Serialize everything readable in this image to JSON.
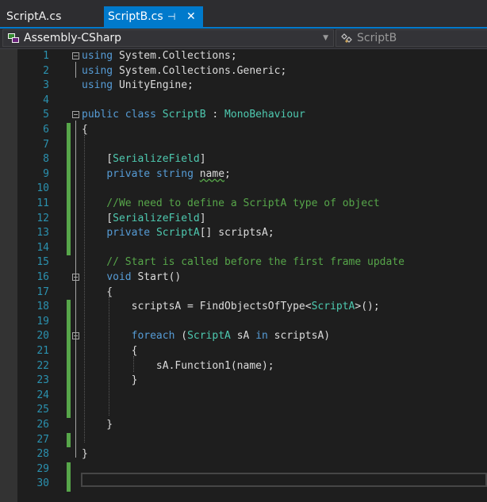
{
  "tabs": [
    {
      "label": "ScriptA.cs",
      "active": false
    },
    {
      "label": "ScriptB.cs",
      "active": true,
      "pin_icon": "pin-icon",
      "close_icon": "close-icon"
    }
  ],
  "nav": {
    "project": "Assembly-CSharp",
    "project_icon": "csharp-project-icon",
    "dropdown_icon": "chevron-down-icon",
    "class": "ScriptB",
    "class_icon": "class-icon"
  },
  "colors": {
    "accent": "#007acc",
    "keyword": "#569cd6",
    "type": "#4ec9b0",
    "comment": "#57a64a",
    "line_number": "#2b91af",
    "text": "#dcdcdc",
    "change_saved": "#57a64a",
    "change_unsaved": "#efef91"
  },
  "editor": {
    "lines": [
      {
        "n": "1",
        "change": "",
        "fold": true,
        "tokens": [
          {
            "t": "using",
            "c": "kw"
          },
          {
            "t": " System.Collections;"
          }
        ]
      },
      {
        "n": "2",
        "change": "",
        "fold": false,
        "tokens": [
          {
            "t": "using",
            "c": "kw"
          },
          {
            "t": " System.Collections.Generic;"
          }
        ]
      },
      {
        "n": "3",
        "change": "",
        "fold": false,
        "tokens": [
          {
            "t": "using",
            "c": "kw"
          },
          {
            "t": " UnityEngine;"
          }
        ]
      },
      {
        "n": "4",
        "change": "",
        "fold": false,
        "tokens": []
      },
      {
        "n": "5",
        "change": "",
        "fold": true,
        "tokens": [
          {
            "t": "public",
            "c": "kw"
          },
          {
            "t": " "
          },
          {
            "t": "class",
            "c": "kw"
          },
          {
            "t": " "
          },
          {
            "t": "ScriptB",
            "c": "ty"
          },
          {
            "t": " : "
          },
          {
            "t": "MonoBehaviour",
            "c": "ty"
          }
        ]
      },
      {
        "n": "6",
        "change": "saved",
        "fold": false,
        "tokens": [
          {
            "t": "{"
          }
        ]
      },
      {
        "n": "7",
        "change": "saved",
        "fold": false,
        "tokens": []
      },
      {
        "n": "8",
        "change": "saved",
        "fold": false,
        "tokens": [
          {
            "t": "    ["
          },
          {
            "t": "SerializeField",
            "c": "ty"
          },
          {
            "t": "]"
          }
        ]
      },
      {
        "n": "9",
        "change": "saved",
        "fold": false,
        "tokens": [
          {
            "t": "    "
          },
          {
            "t": "private",
            "c": "kw"
          },
          {
            "t": " "
          },
          {
            "t": "string",
            "c": "kw"
          },
          {
            "t": " "
          },
          {
            "t": "name",
            "c": "squig"
          },
          {
            "t": ";"
          }
        ]
      },
      {
        "n": "10",
        "change": "saved",
        "fold": false,
        "tokens": []
      },
      {
        "n": "11",
        "change": "saved",
        "fold": false,
        "tokens": [
          {
            "t": "    //We need to define a ScriptA type of object",
            "c": "cm"
          }
        ]
      },
      {
        "n": "12",
        "change": "saved",
        "fold": false,
        "tokens": [
          {
            "t": "    ["
          },
          {
            "t": "SerializeField",
            "c": "ty"
          },
          {
            "t": "]"
          }
        ]
      },
      {
        "n": "13",
        "change": "saved",
        "fold": false,
        "tokens": [
          {
            "t": "    "
          },
          {
            "t": "private",
            "c": "kw"
          },
          {
            "t": " "
          },
          {
            "t": "ScriptA",
            "c": "ty"
          },
          {
            "t": "[] scriptsA;"
          }
        ]
      },
      {
        "n": "14",
        "change": "saved",
        "fold": false,
        "tokens": []
      },
      {
        "n": "15",
        "change": "",
        "fold": false,
        "tokens": [
          {
            "t": "    // Start is called before the first frame update",
            "c": "cm"
          }
        ]
      },
      {
        "n": "16",
        "change": "",
        "fold": true,
        "tokens": [
          {
            "t": "    "
          },
          {
            "t": "void",
            "c": "kw"
          },
          {
            "t": " Start()"
          }
        ]
      },
      {
        "n": "17",
        "change": "",
        "fold": false,
        "tokens": [
          {
            "t": "    {"
          }
        ]
      },
      {
        "n": "18",
        "change": "saved",
        "fold": false,
        "tokens": [
          {
            "t": "        scriptsA = FindObjectsOfType<"
          },
          {
            "t": "ScriptA",
            "c": "ty"
          },
          {
            "t": ">();"
          }
        ]
      },
      {
        "n": "19",
        "change": "saved",
        "fold": false,
        "tokens": []
      },
      {
        "n": "20",
        "change": "saved",
        "fold": true,
        "tokens": [
          {
            "t": "        "
          },
          {
            "t": "foreach",
            "c": "kw"
          },
          {
            "t": " ("
          },
          {
            "t": "ScriptA",
            "c": "ty"
          },
          {
            "t": " sA "
          },
          {
            "t": "in",
            "c": "kw"
          },
          {
            "t": " scriptsA)"
          }
        ]
      },
      {
        "n": "21",
        "change": "saved",
        "fold": false,
        "tokens": [
          {
            "t": "        {"
          }
        ]
      },
      {
        "n": "22",
        "change": "saved",
        "fold": false,
        "tokens": [
          {
            "t": "            sA.Function1(name);"
          }
        ]
      },
      {
        "n": "23",
        "change": "saved",
        "fold": false,
        "tokens": [
          {
            "t": "        }"
          }
        ]
      },
      {
        "n": "24",
        "change": "saved",
        "fold": false,
        "tokens": []
      },
      {
        "n": "25",
        "change": "saved",
        "fold": false,
        "tokens": []
      },
      {
        "n": "26",
        "change": "",
        "fold": false,
        "tokens": [
          {
            "t": "    }"
          }
        ]
      },
      {
        "n": "27",
        "change": "saved",
        "fold": false,
        "tokens": []
      },
      {
        "n": "28",
        "change": "",
        "fold": false,
        "tokens": [
          {
            "t": "}"
          }
        ]
      },
      {
        "n": "29",
        "change": "saved",
        "fold": false,
        "tokens": []
      },
      {
        "n": "30",
        "change": "saved",
        "fold": false,
        "tokens": []
      }
    ]
  }
}
